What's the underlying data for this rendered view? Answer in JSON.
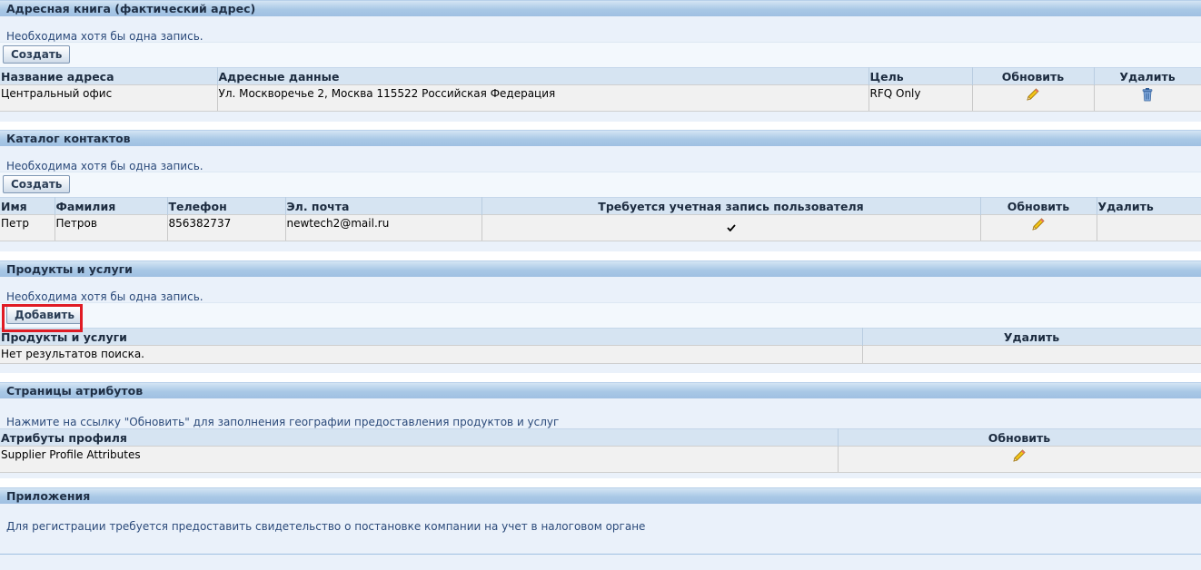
{
  "address_book": {
    "title": "Адресная книга (фактический адрес)",
    "info": "Необходима хотя бы одна запись.",
    "create_label": "Создать",
    "columns": [
      "Название адреса",
      "Адресные данные",
      "Цель",
      "Обновить",
      "Удалить"
    ],
    "rows": [
      {
        "name": "Центральный офис",
        "address": "Ул. Москворечье 2, Москва 115522 Российская Федерация",
        "purpose": "RFQ Only",
        "update_icon": "pencil-icon",
        "delete_icon": "trash-icon"
      }
    ]
  },
  "contacts": {
    "title": "Каталог контактов",
    "info": "Необходима хотя бы одна запись.",
    "create_label": "Создать",
    "columns": [
      "Имя",
      "Фамилия",
      "Телефон",
      "Эл. почта",
      "Требуется учетная запись пользователя",
      "Обновить",
      "Удалить"
    ],
    "rows": [
      {
        "first": "Петр",
        "last": "Петров",
        "phone": "856382737",
        "email": "newtech2@mail.ru",
        "account_required": true,
        "update_icon": "pencil-icon"
      }
    ]
  },
  "products": {
    "title": "Продукты и услуги",
    "info": "Необходима хотя бы одна запись.",
    "add_label": "Добавить",
    "columns": [
      "Продукты и услуги",
      "Удалить"
    ],
    "empty_text": "Нет результатов поиска."
  },
  "attributes": {
    "title": "Страницы атрибутов",
    "info": "Нажмите на ссылку \"Обновить\" для заполнения географии предоставления продуктов и услуг",
    "columns": [
      "Атрибуты профиля",
      "Обновить"
    ],
    "rows": [
      {
        "name": "Supplier Profile Attributes",
        "update_icon": "pencil-icon"
      }
    ]
  },
  "attachments": {
    "title": "Приложения",
    "info": "Для регистрации требуется предоставить свидетельство о постановке компании на учет в налоговом органе"
  },
  "colors": {
    "header_gradient": "#a9c8e6",
    "section_bg": "#eaf1fa",
    "highlight": "#e01b24"
  }
}
